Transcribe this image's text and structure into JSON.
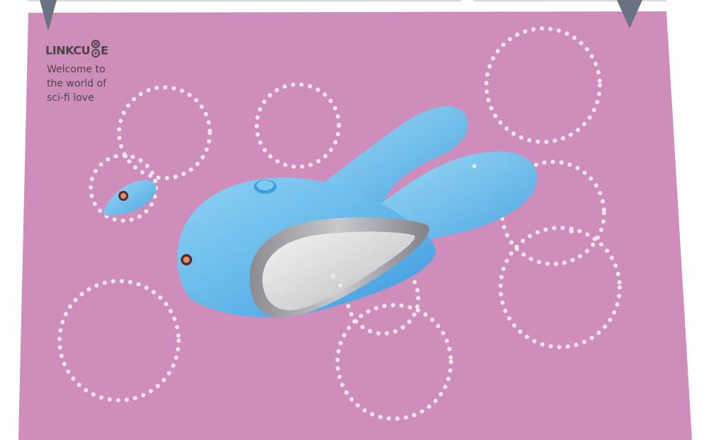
{
  "brand": {
    "name": "LINKCUBE",
    "logo_text": "LINKCU",
    "logo_tail": "E"
  },
  "tagline": {
    "line1": "Welcome to",
    "line2": "the world of",
    "line3": "sci-fi love"
  },
  "colors": {
    "background": "#cf8dbb",
    "product": "#6ab7ea",
    "dots": "#f3e6ef",
    "banner_tab": "#6a7180"
  }
}
